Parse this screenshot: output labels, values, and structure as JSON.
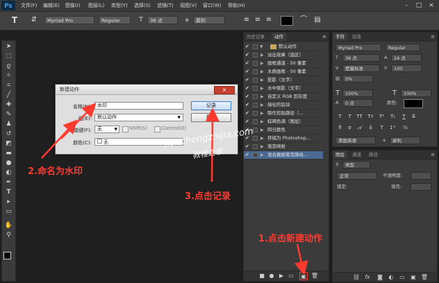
{
  "app": {
    "logo": "Ps",
    "menu": [
      "文件(F)",
      "编辑(E)",
      "图像(I)",
      "图层(L)",
      "类型(Y)",
      "选择(S)",
      "滤镜(T)",
      "视图(V)",
      "窗口(W)",
      "帮助(H)"
    ]
  },
  "options_bar": {
    "font_family": "Myriad Pro",
    "font_style": "Regular",
    "font_size": "36 点",
    "aa_label": "a",
    "aa_value": "犀利"
  },
  "actions_panel": {
    "tabs": [
      "历史记录",
      "动作"
    ],
    "set_name": "默认动作",
    "items": [
      "淡出效果（选区）",
      "画框通道 - 50 像素",
      "木质画框 - 50 像素",
      "投影（文字）",
      "水中倒影（文字）",
      "自定义 RGB 到灰度",
      "熔化的铅块",
      "制作剪贴路径（...",
      "棕褐色调（图层）",
      "四分颜色",
      "存储为 Photoshop...",
      "渐变映射",
      "混合器画笔克隆绘..."
    ]
  },
  "character_panel": {
    "tabs": [
      "字符",
      "段落"
    ],
    "font_family": "Myriad Pro",
    "font_style": "Regular",
    "size": "36 点",
    "leading": "24 点",
    "kerning": "度量标准",
    "tracking": "100",
    "scale_pct": "0%",
    "vscale": "100%",
    "hscale": "100%",
    "baseline": "0 点",
    "color_label": "颜色:",
    "language": "美国英语",
    "aa": "犀利"
  },
  "layers_panel": {
    "tabs": [
      "图层",
      "通道",
      "路径"
    ],
    "filter": "类型",
    "mode": "正常",
    "opacity_label": "不透明度:",
    "lock_label": "锁定:",
    "fill_label": "填充:"
  },
  "dialog": {
    "title": "新建动作",
    "name_label": "名称(N):",
    "name_value": "水印",
    "set_label": "组(E):",
    "set_value": "默认动作",
    "fkey_label": "功能键(F):",
    "fkey_value": "无",
    "shift_label": "Shift(S)",
    "ctrl_label": "Control(O)",
    "color_label": "颜色(C):",
    "color_value": "无",
    "record_button": "记录",
    "cancel_button": "取消"
  },
  "annotations": {
    "step1": "1.点击新建动作",
    "step2": "2.命名为水印",
    "step3": "3.点击记录",
    "watermark_url": "jiaochengzhijia.com",
    "watermark_cn": "教程之家"
  },
  "colors": {
    "annotation_red": "#ff3b30",
    "selection_blue": "#4a6a93"
  }
}
